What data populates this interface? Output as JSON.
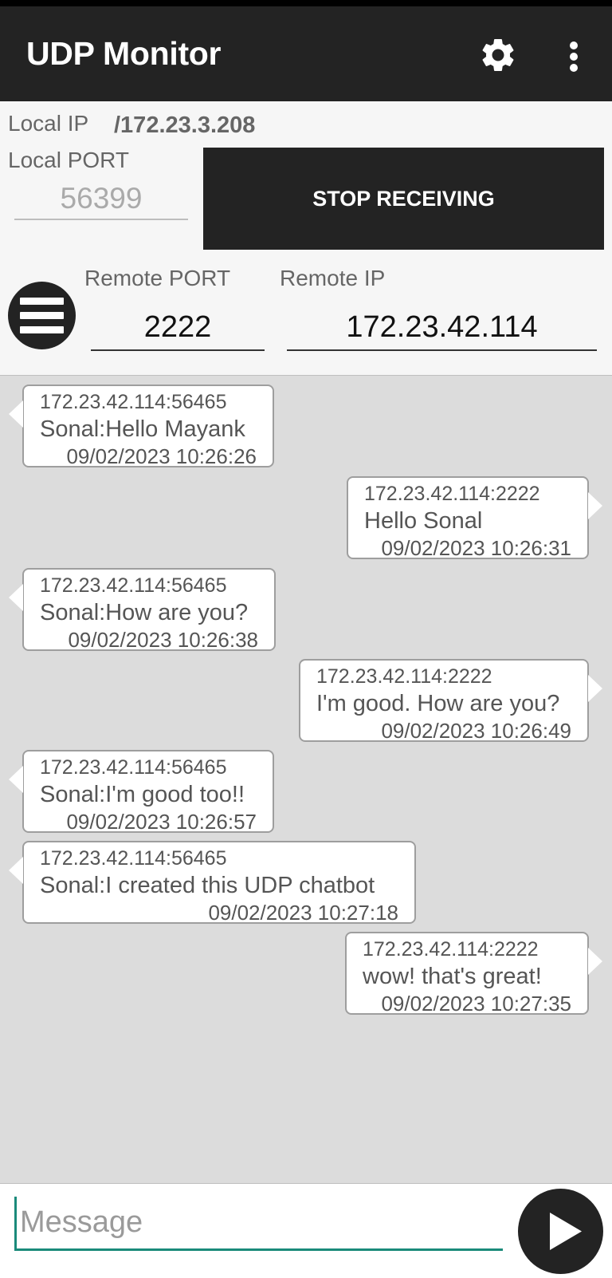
{
  "app": {
    "title": "UDP Monitor",
    "icons": {
      "settings": "gear-icon",
      "overflow": "more-vert-icon"
    }
  },
  "local": {
    "ip_label": "Local IP",
    "ip_value": "/172.23.3.208",
    "port_label": "Local PORT",
    "port_value": "56399"
  },
  "receive_button": {
    "label": "STOP RECEIVING"
  },
  "remote": {
    "port_label": "Remote PORT",
    "port_value": "2222",
    "ip_label": "Remote IP",
    "ip_value": "172.23.42.114"
  },
  "messages": [
    {
      "side": "left",
      "addr": "172.23.42.114:56465",
      "text": "Sonal:Hello Mayank",
      "time": "09/02/2023 10:26:26"
    },
    {
      "side": "right",
      "addr": "172.23.42.114:2222",
      "text": "Hello Sonal",
      "time": "09/02/2023 10:26:31"
    },
    {
      "side": "left",
      "addr": "172.23.42.114:56465",
      "text": "Sonal:How are you?",
      "time": "09/02/2023 10:26:38"
    },
    {
      "side": "right",
      "addr": "172.23.42.114:2222",
      "text": "I'm good. How are you?",
      "time": "09/02/2023 10:26:49"
    },
    {
      "side": "left",
      "addr": "172.23.42.114:56465",
      "text": "Sonal:I'm good too!!",
      "time": "09/02/2023 10:26:57"
    },
    {
      "side": "left",
      "addr": "172.23.42.114:56465",
      "text": "Sonal:I created this UDP chatbot",
      "time": "09/02/2023 10:27:18"
    },
    {
      "side": "right",
      "addr": "172.23.42.114:2222",
      "text": "wow! that's great!",
      "time": "09/02/2023 10:27:35"
    }
  ],
  "composer": {
    "placeholder": "Message",
    "value": "",
    "send_icon": "send-play-icon"
  },
  "colors": {
    "bar": "#232323",
    "chat_bg": "#dcdcdc",
    "accent": "#1a8a7a"
  }
}
